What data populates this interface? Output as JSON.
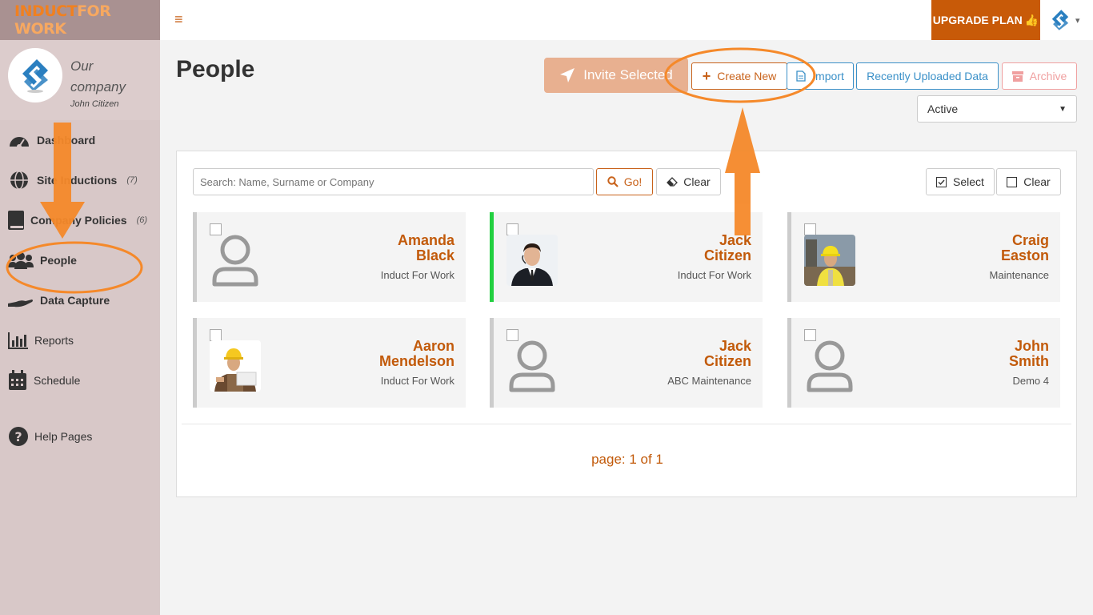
{
  "brand": {
    "logo_part1": "INDUCT",
    "logo_part2": "FOR WORK"
  },
  "company": {
    "name": "Our company",
    "user": "John Citizen"
  },
  "sidebar": {
    "items": [
      {
        "label": "Dashboard",
        "icon": "dashboard-icon",
        "count": ""
      },
      {
        "label": "Site Inductions",
        "icon": "globe-icon",
        "count": "(7)"
      },
      {
        "label": "Company Policies",
        "icon": "book-icon",
        "count": "(6)"
      },
      {
        "label": "People",
        "icon": "people-icon",
        "count": ""
      },
      {
        "label": "Data Capture",
        "icon": "hand-icon",
        "count": ""
      },
      {
        "label": "Reports",
        "icon": "bar-chart-icon",
        "count": ""
      },
      {
        "label": "Schedule",
        "icon": "calendar-icon",
        "count": ""
      },
      {
        "label": "Help Pages",
        "icon": "help-icon",
        "count": ""
      }
    ]
  },
  "topbar": {
    "menu_icon": "hamburger-icon",
    "upgrade_label": "UPGRADE PLAN",
    "upgrade_icon": "thumbs-up-icon"
  },
  "page": {
    "title": "People"
  },
  "toolbar": {
    "invite_label": "Invite Selected",
    "create_label": "Create New",
    "import_label": "Import",
    "recent_label": "Recently Uploaded Data",
    "archive_label": "Archive",
    "status_value": "Active"
  },
  "search": {
    "placeholder": "Search: Name, Surname or Company",
    "go_label": "Go!",
    "clear_label": "Clear",
    "select_label": "Select",
    "clear_select_label": "Clear"
  },
  "people": [
    {
      "first": "Amanda",
      "last": "Black",
      "company": "Induct For Work",
      "photo": "none"
    },
    {
      "first": "Jack",
      "last": "Citizen",
      "company": "Induct For Work",
      "photo": "businessman"
    },
    {
      "first": "Craig",
      "last": "Easton",
      "company": "Maintenance",
      "photo": "worker-site"
    },
    {
      "first": "Aaron",
      "last": "Mendelson",
      "company": "Induct For Work",
      "photo": "worker-hardhat"
    },
    {
      "first": "Jack",
      "last": "Citizen",
      "company": "ABC Maintenance",
      "photo": "none"
    },
    {
      "first": "John",
      "last": "Smith",
      "company": "Demo 4",
      "photo": "none"
    }
  ],
  "pagination": {
    "text": "page: 1 of 1"
  },
  "colors": {
    "accent": "#c25a0a",
    "sidebar": "#d8c8c8",
    "annotation": "#f5892a",
    "active_border": "#22d040"
  }
}
